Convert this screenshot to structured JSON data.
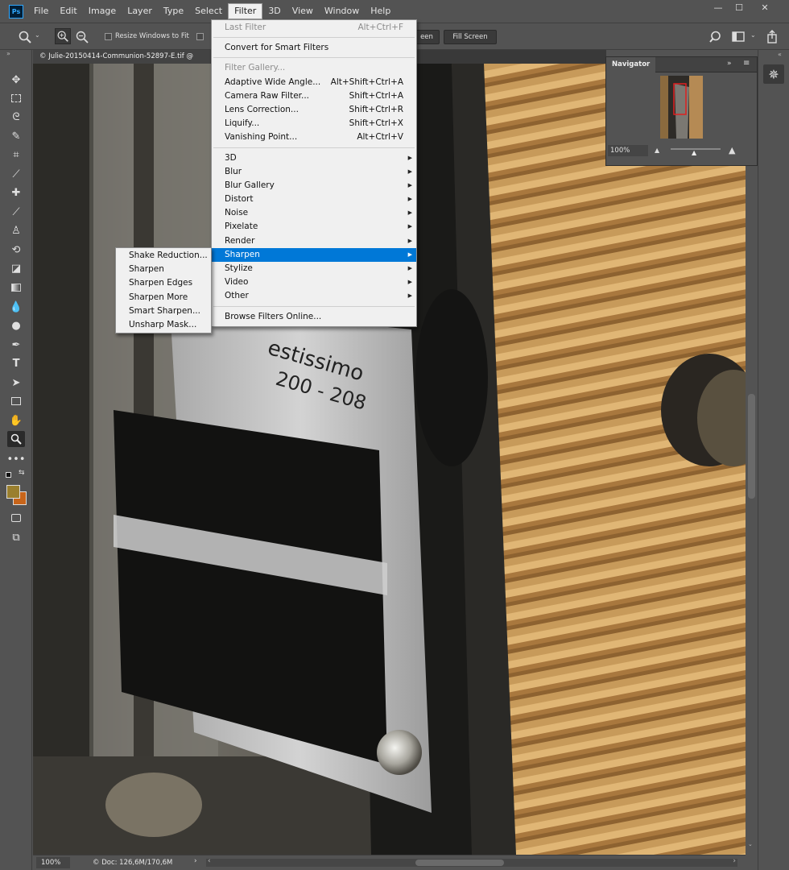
{
  "app": {
    "logo": "Ps"
  },
  "menubar": {
    "items": [
      "File",
      "Edit",
      "Image",
      "Layer",
      "Type",
      "Select",
      "Filter",
      "3D",
      "View",
      "Window",
      "Help"
    ],
    "active": "Filter"
  },
  "options_bar": {
    "resize_windows": "Resize Windows to Fit",
    "fit_screen_partial": "een",
    "fill_screen": "Fill Screen"
  },
  "document": {
    "tab_title": "© Julie-20150414-Communion-52897-E.tif @",
    "zoom": "100%",
    "doc_info": "© Doc: 126,6M/170,6M"
  },
  "navigator": {
    "title": "Navigator",
    "zoom": "100%"
  },
  "filter_menu": {
    "group1": [
      {
        "label": "Last Filter",
        "shortcut": "Alt+Ctrl+F",
        "disabled": true
      }
    ],
    "group2": [
      {
        "label": "Convert for Smart Filters",
        "shortcut": ""
      }
    ],
    "group3": [
      {
        "label": "Filter Gallery...",
        "shortcut": "",
        "disabled": true
      },
      {
        "label": "Adaptive Wide Angle...",
        "shortcut": "Alt+Shift+Ctrl+A"
      },
      {
        "label": "Camera Raw Filter...",
        "shortcut": "Shift+Ctrl+A"
      },
      {
        "label": "Lens Correction...",
        "shortcut": "Shift+Ctrl+R"
      },
      {
        "label": "Liquify...",
        "shortcut": "Shift+Ctrl+X"
      },
      {
        "label": "Vanishing Point...",
        "shortcut": "Alt+Ctrl+V"
      }
    ],
    "group4": [
      {
        "label": "3D"
      },
      {
        "label": "Blur"
      },
      {
        "label": "Blur Gallery"
      },
      {
        "label": "Distort"
      },
      {
        "label": "Noise"
      },
      {
        "label": "Pixelate"
      },
      {
        "label": "Render"
      },
      {
        "label": "Sharpen",
        "highlighted": true
      },
      {
        "label": "Stylize"
      },
      {
        "label": "Video"
      },
      {
        "label": "Other"
      }
    ],
    "group5": [
      {
        "label": "Browse Filters Online..."
      }
    ]
  },
  "sharpen_submenu": [
    "Shake Reduction...",
    "Sharpen",
    "Sharpen Edges",
    "Sharpen More",
    "Smart Sharpen...",
    "Unsharp Mask..."
  ],
  "photo_text": {
    "line1": "estissimo",
    "line2": "200 - 208"
  },
  "colors": {
    "menu_highlight": "#0078d7",
    "foreground_swatch": "#9a7f2e",
    "background_swatch": "#c8651a"
  }
}
